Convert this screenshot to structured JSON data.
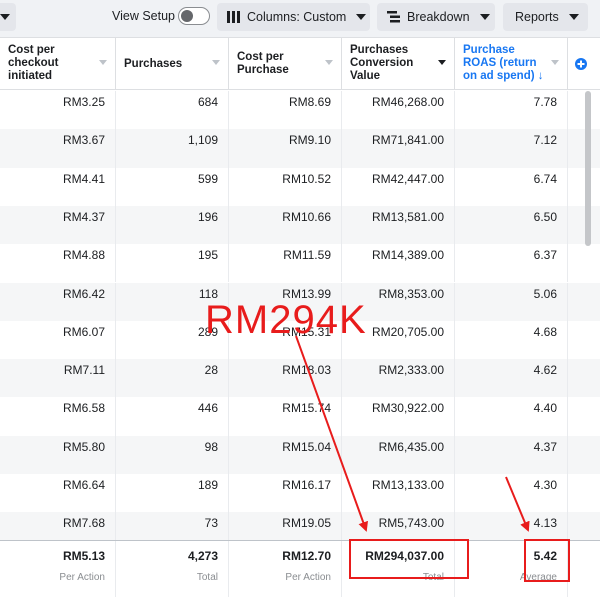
{
  "toolbar": {
    "view_setup": "View Setup",
    "columns_label": "Columns: Custom",
    "breakdown_label": "Breakdown",
    "reports_label": "Reports"
  },
  "headers": [
    {
      "label": "Cost per checkout initiated"
    },
    {
      "label": "Purchases"
    },
    {
      "label": "Cost per Purchase"
    },
    {
      "label": "Purchases Conversion Value"
    },
    {
      "label": "Purchase ROAS (return on ad spend)",
      "sorted": "↓"
    }
  ],
  "rows": [
    [
      "RM3.25",
      "684",
      "RM8.69",
      "RM46,268.00",
      "7.78"
    ],
    [
      "RM3.67",
      "1,109",
      "RM9.10",
      "RM71,841.00",
      "7.12"
    ],
    [
      "RM4.41",
      "599",
      "RM10.52",
      "RM42,447.00",
      "6.74"
    ],
    [
      "RM4.37",
      "196",
      "RM10.66",
      "RM13,581.00",
      "6.50"
    ],
    [
      "RM4.88",
      "195",
      "RM11.59",
      "RM14,389.00",
      "6.37"
    ],
    [
      "RM6.42",
      "118",
      "RM13.99",
      "RM8,353.00",
      "5.06"
    ],
    [
      "RM6.07",
      "289",
      "RM15.31",
      "RM20,705.00",
      "4.68"
    ],
    [
      "RM7.11",
      "28",
      "RM18.03",
      "RM2,333.00",
      "4.62"
    ],
    [
      "RM6.58",
      "446",
      "RM15.74",
      "RM30,922.00",
      "4.40"
    ],
    [
      "RM5.80",
      "98",
      "RM15.04",
      "RM6,435.00",
      "4.37"
    ],
    [
      "RM6.64",
      "189",
      "RM16.17",
      "RM13,133.00",
      "4.30"
    ],
    [
      "RM7.68",
      "73",
      "RM19.05",
      "RM5,743.00",
      "4.13"
    ]
  ],
  "footer": [
    {
      "value": "RM5.13",
      "sub": "Per Action"
    },
    {
      "value": "4,273",
      "sub": "Total"
    },
    {
      "value": "RM12.70",
      "sub": "Per Action"
    },
    {
      "value": "RM294,037.00",
      "sub": "Total"
    },
    {
      "value": "5.42",
      "sub": "Average"
    }
  ],
  "annotation": {
    "label": "RM294K",
    "color": "#e81c1c"
  },
  "colors": {
    "accent": "#1877f2",
    "annotation": "#e81c1c"
  }
}
